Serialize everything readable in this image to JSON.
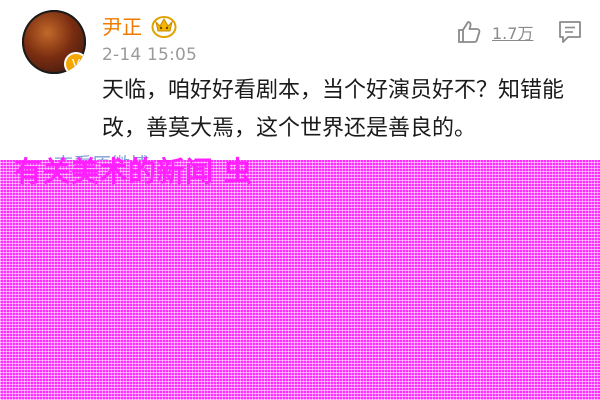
{
  "user": {
    "name": "尹正",
    "avatar_badge": "V"
  },
  "post": {
    "time": "2-14 15:05",
    "content": "天临，咱好好看剧本，当个好演员好不？知错能改，善莫大焉，这个世界还是善良的。"
  },
  "actions": {
    "like_count": "1.7万"
  },
  "footer": {
    "view_link": "查看原微博",
    "headline": "有关美术的新闻 虫"
  },
  "colors": {
    "name": "#f07a00",
    "link": "#7e9ed6",
    "overlay": "#ff2dff"
  },
  "icons": {
    "vip": "vip-crown-icon",
    "like": "thumbs-up-icon",
    "reply": "reply-icon"
  }
}
